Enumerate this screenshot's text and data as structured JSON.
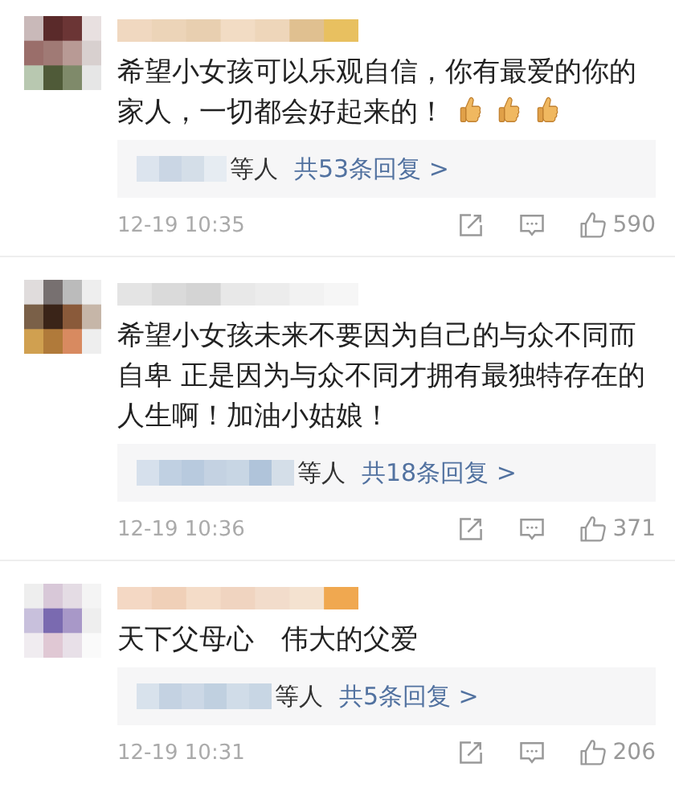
{
  "comments": [
    {
      "text": "希望小女孩可以乐观自信，你有最爱的你的家人，一切都会好起来的！",
      "emojis": [
        {
          "kind": "thumbs-up"
        },
        {
          "kind": "thumbs-up"
        },
        {
          "kind": "thumbs-up"
        }
      ],
      "reply_suffix": "等人",
      "reply_link": "共53条回复 >",
      "time": "12-19 10:35",
      "likes": "590"
    },
    {
      "text": "希望小女孩未来不要因为自己的与众不同而自卑 正是因为与众不同才拥有最独特存在的人生啊！加油小姑娘！",
      "reply_suffix": "等人",
      "reply_link": "共18条回复 >",
      "time": "12-19 10:36",
      "likes": "371"
    },
    {
      "text": "天下父母心　伟大的父爱",
      "reply_suffix": "等人",
      "reply_link": "共5条回复 >",
      "time": "12-19 10:31",
      "likes": "206"
    }
  ]
}
